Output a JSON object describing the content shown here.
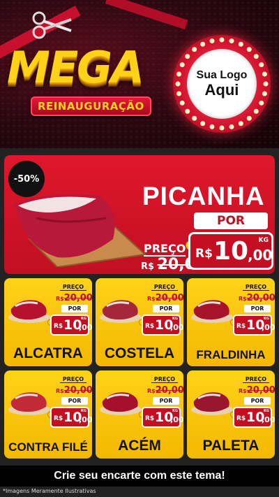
{
  "header": {
    "title_main": "MEGA",
    "title_sub": "REINAUGURAÇÃO",
    "logo_line1": "Sua Logo",
    "logo_line2": "Aqui"
  },
  "hero": {
    "discount": "-50%",
    "product": "PICANHA",
    "price_label": "PREÇO",
    "old_currency": "R$",
    "old_price": "20,00",
    "por_label": "POR",
    "currency": "R$",
    "new_int": "10",
    "new_dec": ",00",
    "unit": "KG"
  },
  "products": [
    {
      "name": "ALCATRA",
      "price_label": "PREÇO",
      "old_currency": "R$",
      "old_price": "20,00",
      "por_label": "POR",
      "currency": "R$",
      "new_int": "10",
      "new_dec": ",00",
      "unit": "KG"
    },
    {
      "name": "COSTELA",
      "price_label": "PREÇO",
      "old_currency": "R$",
      "old_price": "20,00",
      "por_label": "POR",
      "currency": "R$",
      "new_int": "10",
      "new_dec": ",00",
      "unit": "KG"
    },
    {
      "name": "FRALDINHA",
      "price_label": "PREÇO",
      "old_currency": "R$",
      "old_price": "20,00",
      "por_label": "POR",
      "currency": "R$",
      "new_int": "10",
      "new_dec": ",00",
      "unit": "KG"
    },
    {
      "name": "CONTRA FILÉ",
      "price_label": "PREÇO",
      "old_currency": "R$",
      "old_price": "20,00",
      "por_label": "POR",
      "currency": "R$",
      "new_int": "10",
      "new_dec": ",00",
      "unit": "KG"
    },
    {
      "name": "ACÉM",
      "price_label": "PREÇO",
      "old_currency": "R$",
      "old_price": "20,00",
      "por_label": "POR",
      "currency": "R$",
      "new_int": "10",
      "new_dec": ",00",
      "unit": "KG"
    },
    {
      "name": "PALETA",
      "price_label": "PREÇO",
      "old_currency": "R$",
      "old_price": "20,00",
      "por_label": "POR",
      "currency": "R$",
      "new_int": "10",
      "new_dec": ",00",
      "unit": "KG"
    }
  ],
  "footer": {
    "cta": "Crie seu encarte com este tema!",
    "disclaimer": "*Imagens Meramente Ilustrativas"
  },
  "colors": {
    "accent_red": "#c40e22",
    "accent_yellow": "#ffd21a",
    "dark": "#1a1a1a"
  },
  "icons": [
    "scissors-icon",
    "coin-icon"
  ]
}
